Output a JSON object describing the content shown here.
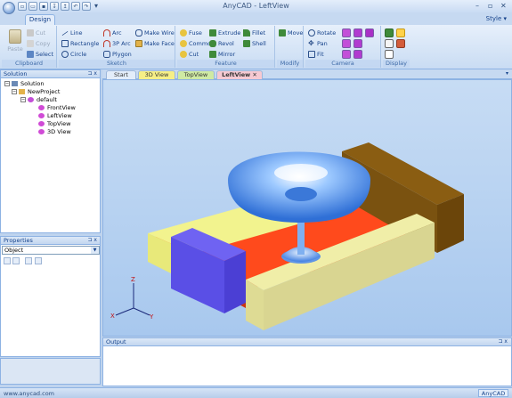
{
  "window": {
    "title": "AnyCAD - LeftView",
    "min": "–",
    "max": "▫",
    "close": "✕"
  },
  "ribbon": {
    "tab": "Design",
    "style_menu": "Style ▾",
    "clipboard": {
      "label": "Clipboard",
      "paste": "Paste",
      "cut": "Cut",
      "copy": "Copy",
      "select": "Select"
    },
    "sketch": {
      "label": "Sketch",
      "line": "Line",
      "rectangle": "Rectangle",
      "circle": "Circle",
      "arc": "Arc",
      "arc3p": "3P Arc",
      "polygon": "Plygon",
      "make_wire": "Make Wire",
      "make_face": "Make Face"
    },
    "feature": {
      "label": "Feature",
      "fuse": "Fuse",
      "common": "Common",
      "cut": "Cut",
      "extrude": "Extrude",
      "revol": "Revol",
      "mirror": "Mirror",
      "fillet": "Fillet",
      "shell": "Shell"
    },
    "modify": {
      "label": "Modify",
      "move": "Move"
    },
    "camera": {
      "label": "Camera",
      "rotate": "Rotate",
      "pan": "Pan",
      "fit": "Fit"
    },
    "display": {
      "label": "Display"
    }
  },
  "solution": {
    "header": "Solution",
    "pin": "\u0003 x",
    "root": "Solution",
    "project": "NewProject",
    "group": "default",
    "views": [
      "FrontView",
      "LeftView",
      "TopView",
      "3D View"
    ]
  },
  "properties": {
    "header": "Properties",
    "pin": "\u0003 x",
    "object": "Object"
  },
  "doc_tabs": [
    "Start",
    "3D View",
    "TopView",
    "LeftView"
  ],
  "output": {
    "header": "Output",
    "pin": "\u0003 x"
  },
  "axes": {
    "x": "X",
    "y": "Y",
    "z": "Z"
  },
  "status": {
    "url": "www.anycad.com",
    "app": "AnyCAD"
  }
}
